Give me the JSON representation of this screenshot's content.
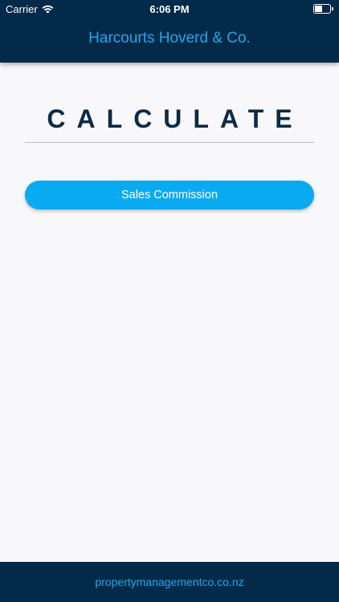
{
  "status_bar": {
    "carrier": "Carrier",
    "time": "6:06 PM",
    "battery_level": 0.5
  },
  "header": {
    "title": "Harcourts Hoverd & Co."
  },
  "main": {
    "heading": "CALCULATE",
    "buttons": [
      {
        "label": "Sales Commission"
      }
    ]
  },
  "footer": {
    "link_text": "propertymanagementco.co.nz"
  },
  "colors": {
    "header_bg": "#042a49",
    "accent": "#23a6ec",
    "button_bg": "#0aaaf2",
    "heading_text": "#0d2a45",
    "page_bg": "#f8f8fa"
  }
}
